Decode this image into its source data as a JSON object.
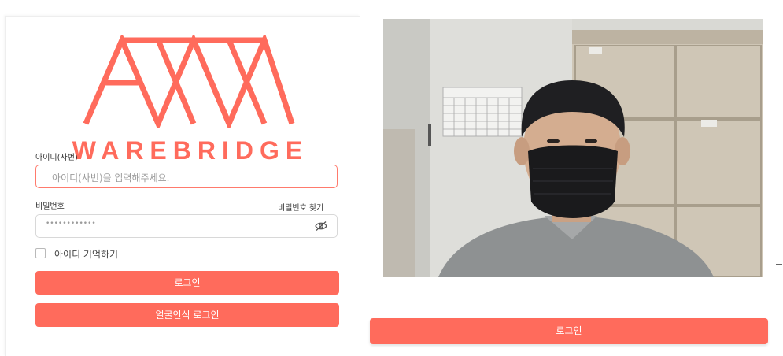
{
  "brand": {
    "name": "WAREBRIDGE",
    "color": "#ff6b5c"
  },
  "login_form": {
    "id_label": "아이디(사번)",
    "id_placeholder": "아이디(사번)을 입력해주세요.",
    "password_label": "비밀번호",
    "password_value_masked": "••••••••••••",
    "find_password_link": "비밀번호 찾기",
    "remember_id_label": "아이디 기억하기",
    "remember_id_checked": false,
    "login_button": "로그인",
    "face_login_button": "얼굴인식 로그인"
  },
  "camera_panel": {
    "login_button": "로그인"
  },
  "icons": {
    "password_toggle": "eye-slash-icon"
  },
  "colors": {
    "accent": "#ff6b5c",
    "input_border_active": "#ff7a6c"
  }
}
